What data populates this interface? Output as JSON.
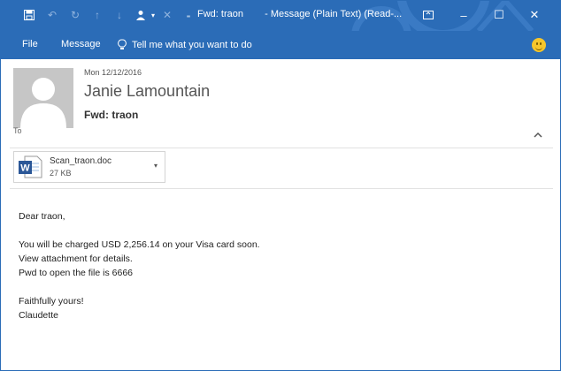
{
  "window": {
    "title": "Fwd: traon",
    "app_title": "- Message (Plain Text) (Read-...",
    "accent_color": "#2b6cb7",
    "controls": {
      "restore_icon": "ribbon-display-icon",
      "minimize": "–",
      "maximize": "☐",
      "close": "✕"
    }
  },
  "quick_access": [
    {
      "icon": "save-icon"
    },
    {
      "icon": "undo-icon"
    },
    {
      "icon": "redo-icon"
    },
    {
      "icon": "up-arrow-icon"
    },
    {
      "icon": "down-arrow-icon"
    },
    {
      "icon": "person-icon"
    },
    {
      "icon": "delete-icon"
    },
    {
      "icon": "customize-icon"
    }
  ],
  "ribbon": {
    "tabs": [
      "File",
      "Message"
    ],
    "tell_me": "Tell me what you want to do"
  },
  "message": {
    "date": "Mon 12/12/2016",
    "sender": "Janie Lamountain",
    "subject": "Fwd: traon",
    "to_label": "To"
  },
  "attachment": {
    "name": "Scan_traon.doc",
    "size": "27 KB",
    "icon": "word-document-icon"
  },
  "body": {
    "greeting": "Dear traon,",
    "line1": "You will be charged USD 2,256.14 on your Visa card soon.",
    "line2": "View attachment for details.",
    "line3": "Pwd to open the file is 6666",
    "closing": "Faithfully yours!",
    "signature": "Claudette"
  }
}
